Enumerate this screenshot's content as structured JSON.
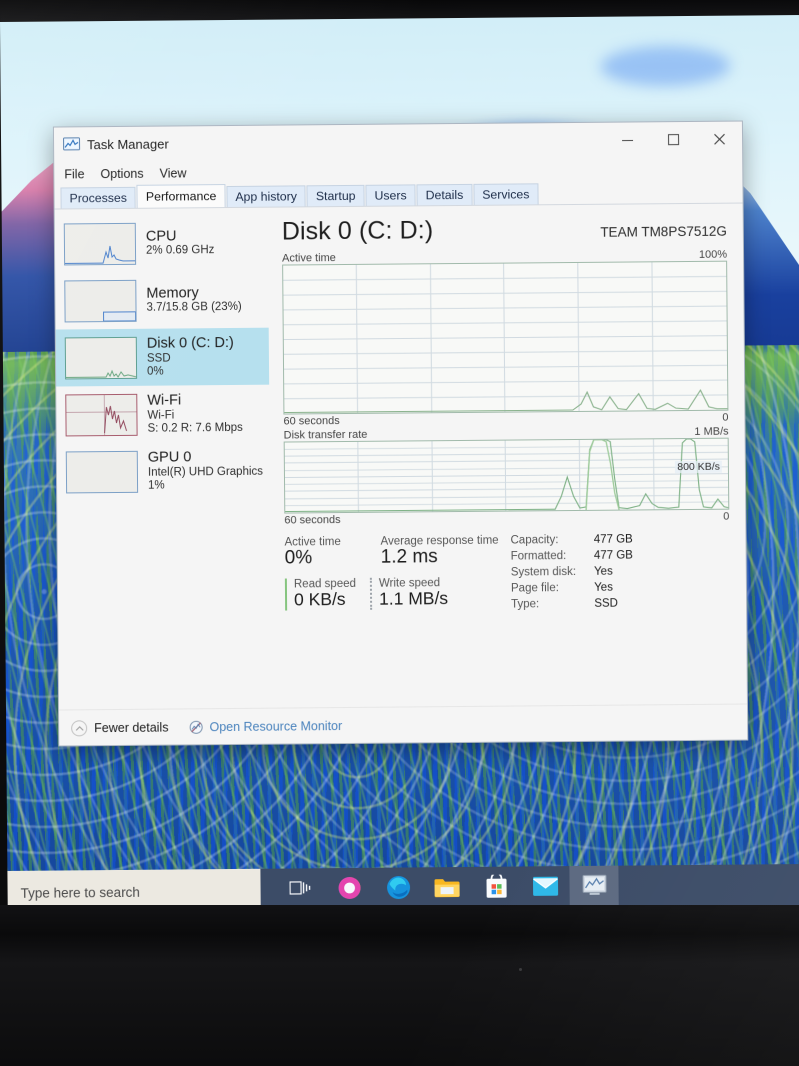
{
  "window": {
    "title": "Task Manager",
    "icon": "task-manager-icon",
    "controls": {
      "minimize": "Minimize",
      "maximize": "Maximize",
      "close": "Close"
    }
  },
  "menu": {
    "items": [
      "File",
      "Options",
      "View"
    ]
  },
  "tabs": {
    "items": [
      "Processes",
      "Performance",
      "App history",
      "Startup",
      "Users",
      "Details",
      "Services"
    ],
    "selected": "Performance"
  },
  "sidebar": {
    "items": [
      {
        "name": "CPU",
        "line1": "2%  0.69 GHz",
        "line2": "",
        "selected": false
      },
      {
        "name": "Memory",
        "line1": "3.7/15.8 GB (23%)",
        "line2": "",
        "selected": false
      },
      {
        "name": "Disk 0 (C: D:)",
        "line1": "SSD",
        "line2": "0%",
        "selected": true
      },
      {
        "name": "Wi-Fi",
        "line1": "Wi-Fi",
        "line2": "S: 0.2 R: 7.6 Mbps",
        "selected": false
      },
      {
        "name": "GPU 0",
        "line1": "Intel(R) UHD Graphics",
        "line2": "1%",
        "selected": false
      }
    ]
  },
  "main": {
    "title": "Disk 0 (C: D:)",
    "model": "TEAM TM8PS7512G",
    "active_graph": {
      "label": "Active time",
      "max_label": "100%",
      "min_label": "0",
      "time_label": "60 seconds"
    },
    "transfer_graph": {
      "label": "Disk transfer rate",
      "max_label": "1 MB/s",
      "min_label": "0",
      "time_label": "60 seconds",
      "tooltip": "800 KB/s"
    },
    "stats": {
      "active_time_label": "Active time",
      "active_time_value": "0%",
      "avg_response_label": "Average response time",
      "avg_response_value": "1.2 ms",
      "read_speed_label": "Read speed",
      "read_speed_value": "0 KB/s",
      "write_speed_label": "Write speed",
      "write_speed_value": "1.1 MB/s"
    },
    "details": [
      {
        "label": "Capacity:",
        "value": "477 GB"
      },
      {
        "label": "Formatted:",
        "value": "477 GB"
      },
      {
        "label": "System disk:",
        "value": "Yes"
      },
      {
        "label": "Page file:",
        "value": "Yes"
      },
      {
        "label": "Type:",
        "value": "SSD"
      }
    ]
  },
  "footer": {
    "fewer_details": "Fewer details",
    "fewer_details_icon": "chevron-up-circle-icon",
    "resource_monitor": "Open Resource Monitor",
    "resource_monitor_icon": "resource-monitor-icon"
  },
  "taskbar": {
    "search_placeholder": "Type here to search",
    "buttons": [
      {
        "icon": "task-view-icon",
        "label": "Task View",
        "active": false
      },
      {
        "icon": "cortana-icon",
        "label": "Cortana",
        "active": false
      },
      {
        "icon": "edge-icon",
        "label": "Microsoft Edge",
        "active": false
      },
      {
        "icon": "file-explorer-icon",
        "label": "File Explorer",
        "active": false
      },
      {
        "icon": "microsoft-store-icon",
        "label": "Microsoft Store",
        "active": false
      },
      {
        "icon": "mail-icon",
        "label": "Mail",
        "active": false
      },
      {
        "icon": "task-manager-taskbar-icon",
        "label": "Task Manager",
        "active": true
      }
    ]
  },
  "colors": {
    "selection": "#b4dbe8",
    "taskbar": "#3c4a63",
    "link": "#4a7fb5",
    "graph_border": "#9fb6a8",
    "graph_line": "#8aaf8d",
    "read_accent": "#86c07f"
  },
  "chart_data": [
    {
      "type": "line",
      "title": "Active time",
      "xlabel": "60 seconds",
      "ylabel": "%",
      "ylim": [
        0,
        100
      ],
      "x": [
        0,
        2,
        4,
        6,
        8,
        10,
        12,
        14,
        16,
        18,
        20,
        22,
        24,
        26,
        28,
        30,
        32,
        34,
        36,
        38,
        40,
        42,
        44,
        46,
        48,
        50,
        52,
        54,
        56,
        58,
        60
      ],
      "values": [
        0,
        0,
        0,
        0,
        0,
        0,
        0,
        0,
        0,
        0,
        0,
        0,
        0,
        0,
        0,
        0,
        0,
        0,
        0,
        0,
        0,
        1,
        6,
        2,
        9,
        1,
        7,
        1,
        2,
        1,
        13
      ]
    },
    {
      "type": "line",
      "title": "Disk transfer rate",
      "xlabel": "60 seconds",
      "ylabel": "MB/s",
      "ylim": [
        0,
        1
      ],
      "annotation": "800 KB/s",
      "x": [
        0,
        2,
        4,
        6,
        8,
        10,
        12,
        14,
        16,
        18,
        20,
        22,
        24,
        26,
        28,
        30,
        32,
        34,
        36,
        38,
        40,
        42,
        44,
        46,
        48,
        50,
        52,
        54,
        56,
        58,
        60
      ],
      "values": [
        0,
        0,
        0,
        0,
        0,
        0,
        0,
        0,
        0,
        0,
        0,
        0,
        0,
        0,
        0,
        0,
        0,
        0,
        0,
        0,
        0.02,
        0.22,
        0.03,
        0.95,
        1.0,
        0.9,
        0.03,
        0.18,
        0.02,
        0.9,
        0.15
      ]
    }
  ]
}
